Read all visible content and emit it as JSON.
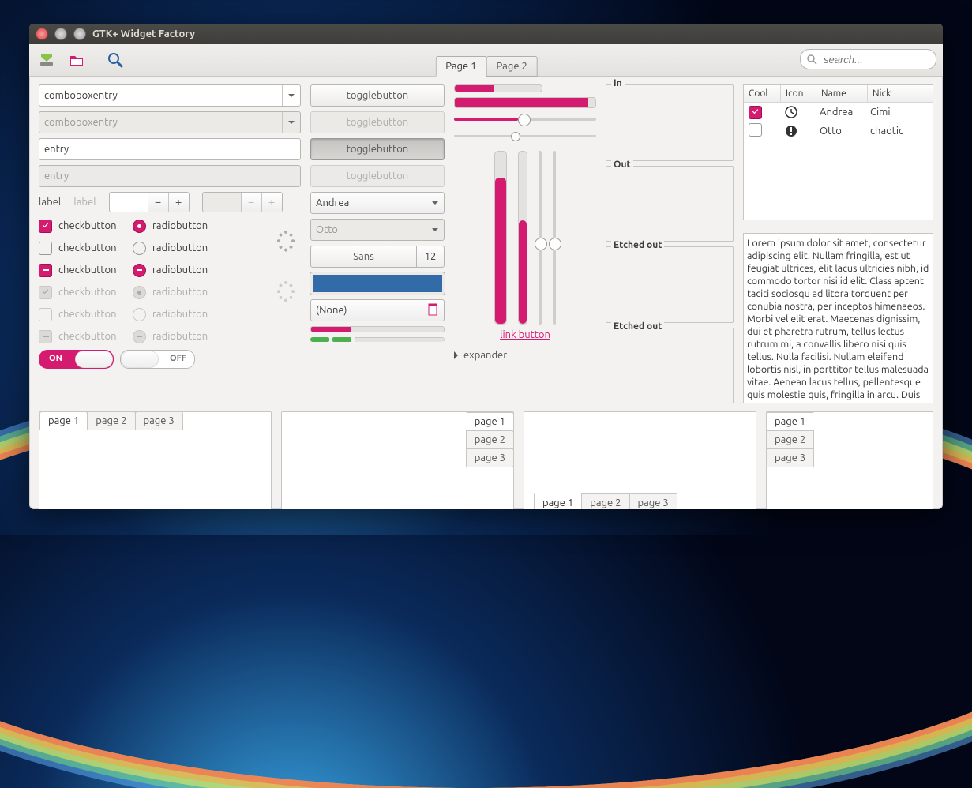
{
  "window": {
    "title": "GTK+ Widget Factory"
  },
  "toolbar": {
    "page_tabs": [
      "Page 1",
      "Page 2"
    ],
    "active_page": 0,
    "search_placeholder": "search..."
  },
  "col1": {
    "combobox1": "comboboxentry",
    "combobox2": "comboboxentry",
    "entry1": "entry",
    "entry2": "entry",
    "label1": "label",
    "label2": "label",
    "checks": [
      {
        "check": "on",
        "radio": "on",
        "dim": false
      },
      {
        "check": "off",
        "radio": "off",
        "dim": false
      },
      {
        "check": "mixed",
        "radio": "mixed",
        "dim": false
      },
      {
        "check": "on",
        "radio": "on",
        "dim": true
      },
      {
        "check": "off",
        "radio": "off",
        "dim": true
      },
      {
        "check": "mixed",
        "radio": "mixed",
        "dim": true
      }
    ],
    "check_label": "checkbutton",
    "radio_label": "radiobutton",
    "switch_on": "ON",
    "switch_off": "OFF"
  },
  "col2": {
    "toggles": [
      {
        "label": "togglebutton",
        "state": "normal"
      },
      {
        "label": "togglebutton",
        "state": "disabled"
      },
      {
        "label": "togglebutton",
        "state": "active"
      },
      {
        "label": "togglebutton",
        "state": "disabled"
      }
    ],
    "combo1": "Andrea",
    "combo2": "Otto",
    "font_name": "Sans",
    "font_size": "12",
    "color": "#336aa8",
    "file_label": "(None)",
    "progress_green": 30,
    "progress_segments": 2
  },
  "col3": {
    "h_small": 45,
    "h_wide": 95,
    "slider1": 45,
    "slider2": 40,
    "v1": 85,
    "v2": 60,
    "v3": 56,
    "v4": 56,
    "link_label": "link button",
    "expander_label": "expander"
  },
  "col4": {
    "frames": [
      "In",
      "Out",
      "Etched out",
      "Etched out"
    ]
  },
  "col5": {
    "columns": [
      "Cool",
      "Icon",
      "Name",
      "Nick"
    ],
    "rows": [
      {
        "cool": true,
        "icon": "clock",
        "name": "Andrea",
        "nick": "Cimi"
      },
      {
        "cool": false,
        "icon": "warn",
        "name": "Otto",
        "nick": "chaotic"
      }
    ],
    "lorem": "Lorem ipsum dolor sit amet, consectetur adipiscing elit. Nullam fringilla, est ut feugiat ultrices, elit lacus ultricies nibh, id commodo tortor nisi id elit. Class aptent taciti sociosqu ad litora torquent per conubia nostra, per inceptos himenaeos. Morbi vel elit erat. Maecenas dignissim, dui et pharetra rutrum, tellus lectus rutrum mi, a convallis libero nisi quis tellus. Nulla facilisi. Nullam eleifend lobortis nisl, in porttitor tellus malesuada vitae. Aenean lacus tellus, pellentesque quis molestie quis, fringilla in arcu. Duis elementum, tellus sed tristique semper, metus metus accumsan augue, et porttitor augue orci a libero. Ut sed justo ac felis placerat laoreet sed id sem. Proin mattis tincidunt odio vitae tristique. Morbi massa libero, congue vitae scelerisque vel, ultricies vel nisl. Vestibulum in tortor diam, quis aliquet quam. Praesent ut justo neque, tempus rutrum est. Duis eu lectus quam. Vivamus eget metus a mauris molestie venenatis pulvinar eleifend nisi."
  },
  "notebooks": {
    "pages": [
      "page 1",
      "page 2",
      "page 3"
    ]
  }
}
